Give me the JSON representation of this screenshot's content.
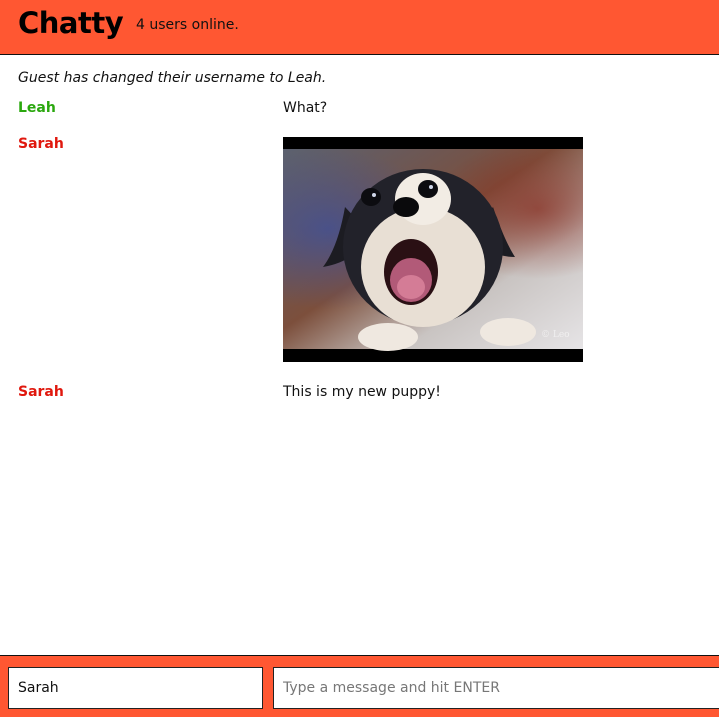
{
  "navbar": {
    "brand": "Chatty",
    "online_count": "4 users online."
  },
  "messages": {
    "system_notice": "Guest has changed their username to Leah.",
    "items": [
      {
        "username": "Leah",
        "content": "What?",
        "color": "#2aa70e",
        "type": "text"
      },
      {
        "username": "Sarah",
        "content": "",
        "color": "#e0180e",
        "type": "image",
        "image": "puppy-photo"
      },
      {
        "username": "Sarah",
        "content": "This is my new puppy!",
        "color": "#e0180e",
        "type": "text"
      }
    ]
  },
  "footer": {
    "username_value": "Sarah",
    "message_placeholder": "Type a message and hit ENTER"
  },
  "colors": {
    "accent": "#FF5732",
    "leah": "#2aa70e",
    "sarah": "#e0180e"
  }
}
